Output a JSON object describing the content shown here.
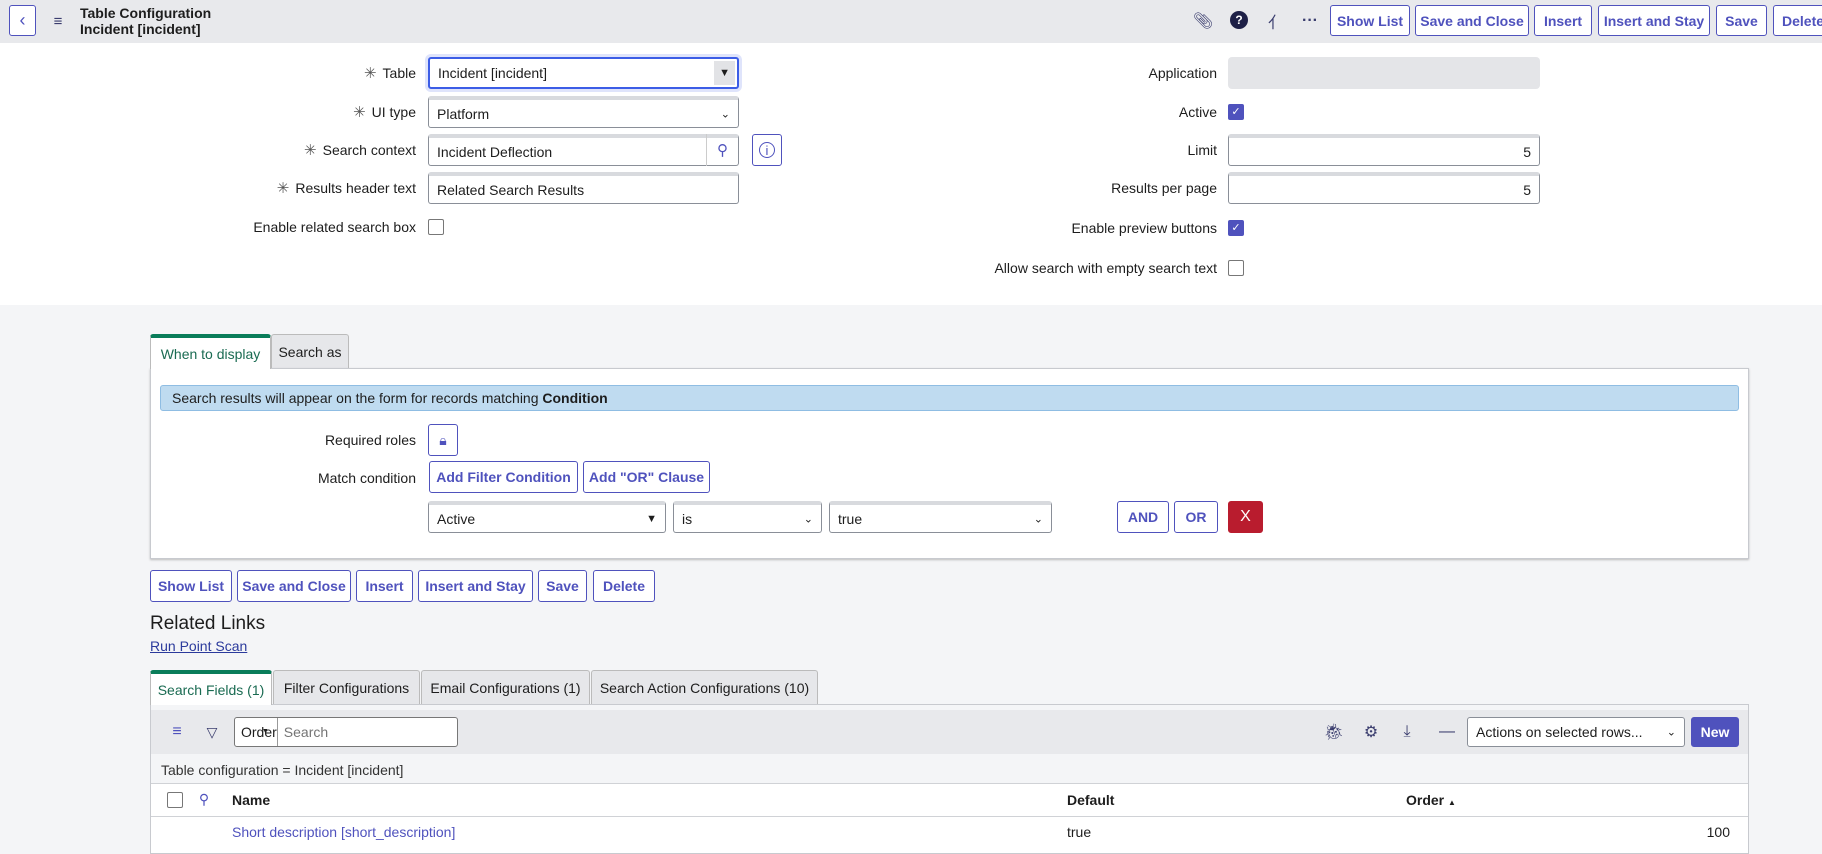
{
  "header": {
    "title": "Table Configuration",
    "subtitle": "Incident [incident]",
    "buttons": [
      "Show List",
      "Save and Close",
      "Insert",
      "Insert and Stay",
      "Save",
      "Delete"
    ]
  },
  "form": {
    "table": {
      "label": "Table",
      "value": "Incident [incident]"
    },
    "ui_type": {
      "label": "UI type",
      "value": "Platform"
    },
    "search_context": {
      "label": "Search context",
      "value": "Incident Deflection"
    },
    "results_header": {
      "label": "Results header text",
      "value": "Related Search Results"
    },
    "enable_related": {
      "label": "Enable related search box",
      "checked": false
    },
    "application": {
      "label": "Application",
      "value": ""
    },
    "active": {
      "label": "Active",
      "checked": true
    },
    "limit": {
      "label": "Limit",
      "value": "5"
    },
    "results_per_page": {
      "label": "Results per page",
      "value": "5"
    },
    "enable_preview": {
      "label": "Enable preview buttons",
      "checked": true
    },
    "allow_empty": {
      "label": "Allow search with empty search text",
      "checked": false
    }
  },
  "section_tabs": [
    "When to display",
    "Search as"
  ],
  "condition": {
    "info_prefix": "Search results will appear on the form for records matching ",
    "info_bold": "Condition",
    "required_roles": "Required roles",
    "match_condition": "Match condition",
    "add_filter": "Add Filter Condition",
    "add_or": "Add \"OR\" Clause",
    "field": "Active",
    "operator": "is",
    "value": "true",
    "and": "AND",
    "or": "OR",
    "remove": "X"
  },
  "footer_buttons": [
    "Show List",
    "Save and Close",
    "Insert",
    "Insert and Stay",
    "Save",
    "Delete"
  ],
  "related": {
    "title": "Related Links",
    "link": "Run Point Scan"
  },
  "list_tabs": [
    "Search Fields (1)",
    "Filter Configurations",
    "Email Configurations (1)",
    "Search Action Configurations (10)"
  ],
  "list": {
    "search_field": "Order",
    "search_placeholder": "Search",
    "actions": "Actions on selected rows...",
    "new": "New",
    "breadcrumb": "Table configuration = Incident [incident]",
    "columns": [
      "Name",
      "Default",
      "Order"
    ],
    "rows": [
      {
        "name": "Short description [short_description]",
        "default": "true",
        "order": "100"
      }
    ]
  },
  "colors": {
    "accent": "#4f52bd",
    "tab_active": "#0a7d5a",
    "danger": "#b91c2e",
    "info": "#bfdbf0"
  }
}
